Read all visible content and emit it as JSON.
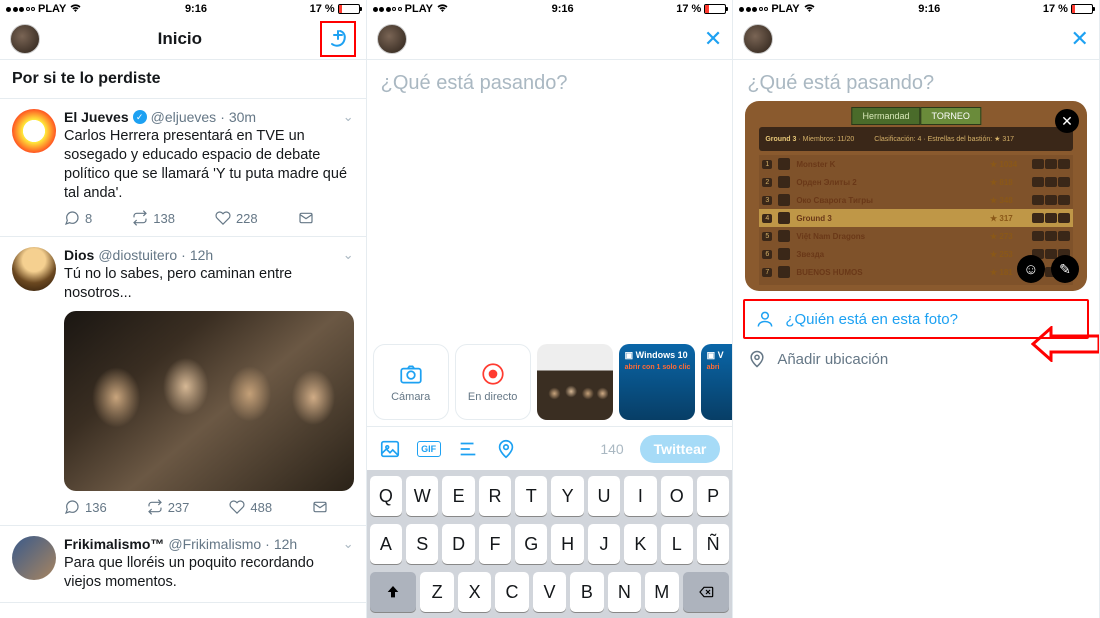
{
  "status": {
    "carrier": "PLAY",
    "time": "9:16",
    "battery_pct": "17 %"
  },
  "panel1": {
    "title": "Inicio",
    "section": "Por si te lo perdiste",
    "tweets": [
      {
        "name": "El Jueves",
        "verified": true,
        "handle": "@eljueves",
        "time": "30m",
        "text": "Carlos Herrera presentará en TVE un sosegado y educado espacio de debate político que se llamará 'Y tu puta madre qué tal anda'.",
        "replies": "8",
        "retweets": "138",
        "likes": "228"
      },
      {
        "name": "Dios",
        "verified": false,
        "handle": "@diostuitero",
        "time": "12h",
        "text": "Tú no lo sabes, pero caminan entre nosotros...",
        "replies": "136",
        "retweets": "237",
        "likes": "488",
        "media": true
      },
      {
        "name": "Frikimalismo™",
        "verified": false,
        "handle": "@Frikimalismo",
        "time": "12h",
        "text": "Para que lloréis un poquito recordando viejos momentos."
      }
    ]
  },
  "panel2": {
    "placeholder": "¿Qué está pasando?",
    "camera": "Cámara",
    "live": "En directo",
    "thumb_win_title": "Windows 10",
    "thumb_win_sub": "abrir con 1 solo clic",
    "char_count": "140",
    "tweet_btn": "Twittear",
    "gif_label": "GIF"
  },
  "panel3": {
    "placeholder": "¿Qué está pasando?",
    "game": {
      "tab1": "Hermandad",
      "tab2": "TORNEO",
      "guild": "Ground 3",
      "members": "Miembros: 11/20",
      "class_label": "Clasificación: 4",
      "bastion": "Estrellas del bastión: ★ 317",
      "rows": [
        {
          "rank": "1",
          "name": "Monster K",
          "score": "★ 1034"
        },
        {
          "rank": "2",
          "name": "Орден Элиты 2",
          "score": "★ 818"
        },
        {
          "rank": "3",
          "name": "Око Сварога Тигры",
          "score": "★ 348"
        },
        {
          "rank": "4",
          "name": "Ground 3",
          "score": "★ 317",
          "hi": true
        },
        {
          "rank": "5",
          "name": "Việt Nam Dragons",
          "score": "★ 273"
        },
        {
          "rank": "6",
          "name": "Звезда",
          "score": "★ 253"
        },
        {
          "rank": "7",
          "name": "BUENOS HUMOS",
          "score": "★ 181"
        }
      ]
    },
    "tag_people": "¿Quién está en esta foto?",
    "add_location": "Añadir ubicación"
  },
  "keys": {
    "r1": [
      "Q",
      "W",
      "E",
      "R",
      "T",
      "Y",
      "U",
      "I",
      "O",
      "P"
    ],
    "r2": [
      "A",
      "S",
      "D",
      "F",
      "G",
      "H",
      "J",
      "K",
      "L",
      "Ñ"
    ],
    "r3": [
      "Z",
      "X",
      "C",
      "V",
      "B",
      "N",
      "M"
    ]
  }
}
